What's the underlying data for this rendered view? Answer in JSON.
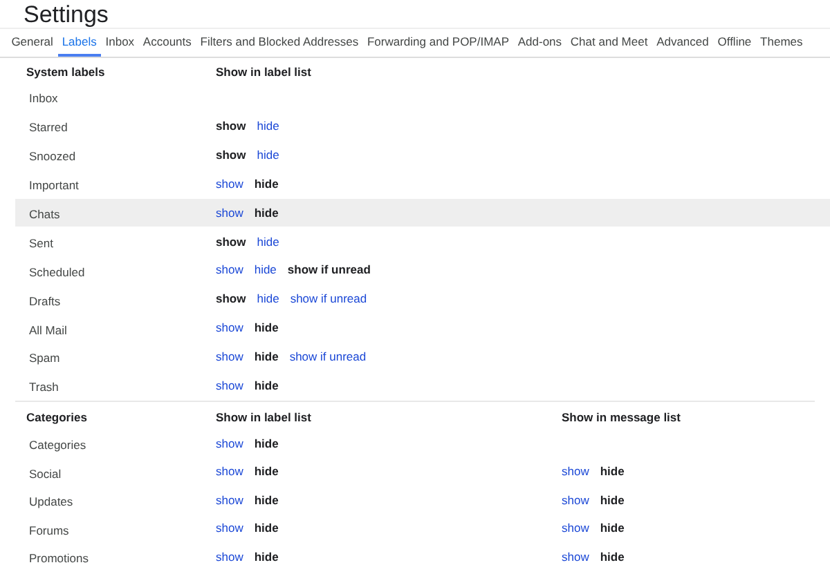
{
  "title": "Settings",
  "tabs": [
    {
      "label": "General",
      "selected": false
    },
    {
      "label": "Labels",
      "selected": true
    },
    {
      "label": "Inbox",
      "selected": false
    },
    {
      "label": "Accounts",
      "selected": false
    },
    {
      "label": "Filters and Blocked Addresses",
      "selected": false
    },
    {
      "label": "Forwarding and POP/IMAP",
      "selected": false
    },
    {
      "label": "Add-ons",
      "selected": false
    },
    {
      "label": "Chat and Meet",
      "selected": false
    },
    {
      "label": "Advanced",
      "selected": false
    },
    {
      "label": "Offline",
      "selected": false
    },
    {
      "label": "Themes",
      "selected": false
    }
  ],
  "system_labels": {
    "columns": [
      "System labels",
      "Show in label list"
    ],
    "rows": [
      {
        "label": "Inbox",
        "highlighted": false,
        "label_list": []
      },
      {
        "label": "Starred",
        "highlighted": false,
        "label_list": [
          {
            "label": "show",
            "selected": true
          },
          {
            "label": "hide",
            "selected": false
          }
        ]
      },
      {
        "label": "Snoozed",
        "highlighted": false,
        "label_list": [
          {
            "label": "show",
            "selected": true
          },
          {
            "label": "hide",
            "selected": false
          }
        ]
      },
      {
        "label": "Important",
        "highlighted": false,
        "label_list": [
          {
            "label": "show",
            "selected": false
          },
          {
            "label": "hide",
            "selected": true
          }
        ]
      },
      {
        "label": "Chats",
        "highlighted": true,
        "label_list": [
          {
            "label": "show",
            "selected": false
          },
          {
            "label": "hide",
            "selected": true
          }
        ]
      },
      {
        "label": "Sent",
        "highlighted": false,
        "label_list": [
          {
            "label": "show",
            "selected": true
          },
          {
            "label": "hide",
            "selected": false
          }
        ]
      },
      {
        "label": "Scheduled",
        "highlighted": false,
        "label_list": [
          {
            "label": "show",
            "selected": false
          },
          {
            "label": "hide",
            "selected": false
          },
          {
            "label": "show if unread",
            "selected": true
          }
        ]
      },
      {
        "label": "Drafts",
        "highlighted": false,
        "label_list": [
          {
            "label": "show",
            "selected": true
          },
          {
            "label": "hide",
            "selected": false
          },
          {
            "label": "show if unread",
            "selected": false
          }
        ]
      },
      {
        "label": "All Mail",
        "highlighted": false,
        "label_list": [
          {
            "label": "show",
            "selected": false
          },
          {
            "label": "hide",
            "selected": true
          }
        ]
      },
      {
        "label": "Spam",
        "highlighted": false,
        "label_list": [
          {
            "label": "show",
            "selected": false
          },
          {
            "label": "hide",
            "selected": true
          },
          {
            "label": "show if unread",
            "selected": false
          }
        ]
      },
      {
        "label": "Trash",
        "highlighted": false,
        "label_list": [
          {
            "label": "show",
            "selected": false
          },
          {
            "label": "hide",
            "selected": true
          }
        ]
      }
    ]
  },
  "categories": {
    "columns": [
      "Categories",
      "Show in label list",
      "Show in message list"
    ],
    "rows": [
      {
        "label": "Categories",
        "label_list": [
          {
            "label": "show",
            "selected": false
          },
          {
            "label": "hide",
            "selected": true
          }
        ],
        "message_list": []
      },
      {
        "label": "Social",
        "label_list": [
          {
            "label": "show",
            "selected": false
          },
          {
            "label": "hide",
            "selected": true
          }
        ],
        "message_list": [
          {
            "label": "show",
            "selected": false
          },
          {
            "label": "hide",
            "selected": true
          }
        ]
      },
      {
        "label": "Updates",
        "label_list": [
          {
            "label": "show",
            "selected": false
          },
          {
            "label": "hide",
            "selected": true
          }
        ],
        "message_list": [
          {
            "label": "show",
            "selected": false
          },
          {
            "label": "hide",
            "selected": true
          }
        ]
      },
      {
        "label": "Forums",
        "label_list": [
          {
            "label": "show",
            "selected": false
          },
          {
            "label": "hide",
            "selected": true
          }
        ],
        "message_list": [
          {
            "label": "show",
            "selected": false
          },
          {
            "label": "hide",
            "selected": true
          }
        ]
      },
      {
        "label": "Promotions",
        "label_list": [
          {
            "label": "show",
            "selected": false
          },
          {
            "label": "hide",
            "selected": true
          }
        ],
        "message_list": [
          {
            "label": "show",
            "selected": false
          },
          {
            "label": "hide",
            "selected": true
          }
        ]
      }
    ]
  }
}
